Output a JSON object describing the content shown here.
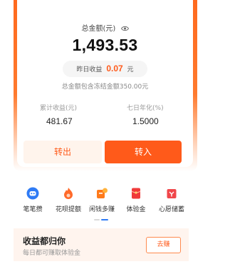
{
  "balance": {
    "total_label": "总金额(元)",
    "total_amount": "1,493.53",
    "yesterday_label": "昨日收益",
    "yesterday_value": "0.07",
    "yesterday_unit": "元",
    "frozen_note": "总金额包含冻结金额350.00元"
  },
  "stats": {
    "cumulative_label": "累计收益(元)",
    "cumulative_value": "481.67",
    "annualized_label": "七日年化(%)",
    "annualized_value": "1.5000"
  },
  "actions": {
    "transfer_out": "转出",
    "transfer_in": "转入"
  },
  "quick_menu": {
    "items": [
      {
        "label": "笔笔攒",
        "icon": "robot-icon"
      },
      {
        "label": "花呗提额",
        "icon": "flame-icon"
      },
      {
        "label": "闲钱多赚",
        "icon": "puzzle-icon"
      },
      {
        "label": "体验金",
        "icon": "red-envelope-icon"
      },
      {
        "label": "心愿储蓄",
        "icon": "gift-icon"
      }
    ]
  },
  "banner": {
    "title": "收益都归你",
    "subtitle": "每日都可赚取体验金",
    "button": "去赚"
  },
  "colors": {
    "accent": "#ff5a1a",
    "accent_light": "#fff4ec"
  }
}
